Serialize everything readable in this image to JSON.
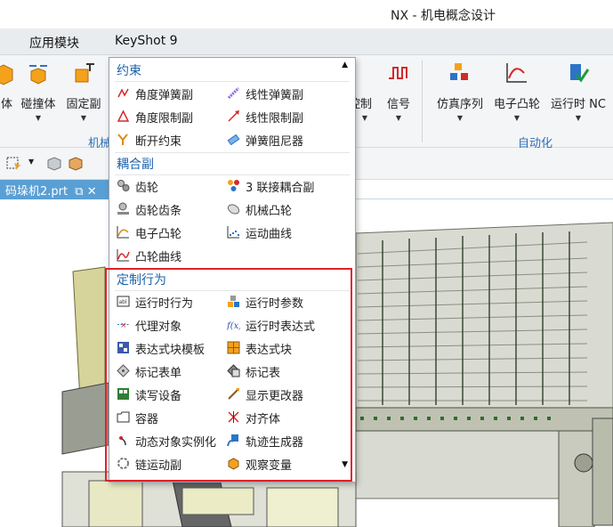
{
  "window": {
    "title": "NX - 机电概念设计"
  },
  "menubar": {
    "items": [
      "应用模块",
      "KeyShot 9"
    ]
  },
  "ribbon": {
    "left_buttons": [
      {
        "label": "体",
        "icon": "body-icon"
      },
      {
        "label": "碰撞体",
        "icon": "collision-body-icon"
      },
      {
        "label": "固定副",
        "icon": "fixed-joint-icon"
      }
    ],
    "right_buttons": [
      {
        "label": "控制",
        "icon": "control-icon"
      },
      {
        "label": "信号",
        "icon": "signal-icon"
      },
      {
        "label": "仿真序列",
        "icon": "simulation-sequence-icon"
      },
      {
        "label": "电子凸轮",
        "icon": "electronic-cam-icon"
      },
      {
        "label": "运行时 NC",
        "icon": "runtime-nc-icon"
      }
    ],
    "groups": {
      "mechanical": "机械",
      "automation": "自动化"
    }
  },
  "file_tab": {
    "label": "码垛机2.prt"
  },
  "dropdown": {
    "sections": [
      {
        "header": "约束",
        "items": [
          {
            "label": "角度弹簧副",
            "icon": "angular-spring-joint-icon"
          },
          {
            "label": "线性弹簧副",
            "icon": "linear-spring-joint-icon"
          },
          {
            "label": "角度限制副",
            "icon": "angular-limit-joint-icon"
          },
          {
            "label": "线性限制副",
            "icon": "linear-limit-joint-icon"
          },
          {
            "label": "断开约束",
            "icon": "breaking-constraint-icon"
          },
          {
            "label": "弹簧阻尼器",
            "icon": "spring-damper-icon"
          }
        ]
      },
      {
        "header": "耦合副",
        "items": [
          {
            "label": "齿轮",
            "icon": "gear-icon"
          },
          {
            "label": "3 联接耦合副",
            "icon": "three-joint-coupler-icon"
          },
          {
            "label": "齿轮齿条",
            "icon": "rack-pinion-icon"
          },
          {
            "label": "机械凸轮",
            "icon": "mechanical-cam-icon"
          },
          {
            "label": "电子凸轮",
            "icon": "electronic-cam-icon"
          },
          {
            "label": "运动曲线",
            "icon": "motion-profile-icon"
          },
          {
            "label": "凸轮曲线",
            "icon": "cam-profile-icon"
          }
        ]
      },
      {
        "header": "定制行为",
        "items": [
          {
            "label": "运行时行为",
            "icon": "runtime-behavior-icon"
          },
          {
            "label": "运行时参数",
            "icon": "runtime-parameters-icon"
          },
          {
            "label": "代理对象",
            "icon": "proxy-object-icon"
          },
          {
            "label": "运行时表达式",
            "icon": "runtime-expression-icon"
          },
          {
            "label": "表达式块模板",
            "icon": "expression-block-template-icon"
          },
          {
            "label": "表达式块",
            "icon": "expression-block-icon"
          },
          {
            "label": "标记表单",
            "icon": "tag-form-icon"
          },
          {
            "label": "标记表",
            "icon": "tag-table-icon"
          },
          {
            "label": "读写设备",
            "icon": "read-write-device-icon"
          },
          {
            "label": "显示更改器",
            "icon": "display-changer-icon"
          },
          {
            "label": "容器",
            "icon": "container-icon"
          },
          {
            "label": "对齐体",
            "icon": "align-body-icon"
          },
          {
            "label": "动态对象实例化",
            "icon": "object-instancer-icon"
          },
          {
            "label": "轨迹生成器",
            "icon": "path-generator-icon"
          },
          {
            "label": "链运动副",
            "icon": "chain-joint-icon"
          },
          {
            "label": "观察变量",
            "icon": "watch-variable-icon"
          }
        ]
      }
    ]
  },
  "colors": {
    "header_blue": "#1e63ad",
    "highlight_red": "#e0222a",
    "tab_blue": "#5a9fd4",
    "automation_group": "#2a6fb6"
  }
}
